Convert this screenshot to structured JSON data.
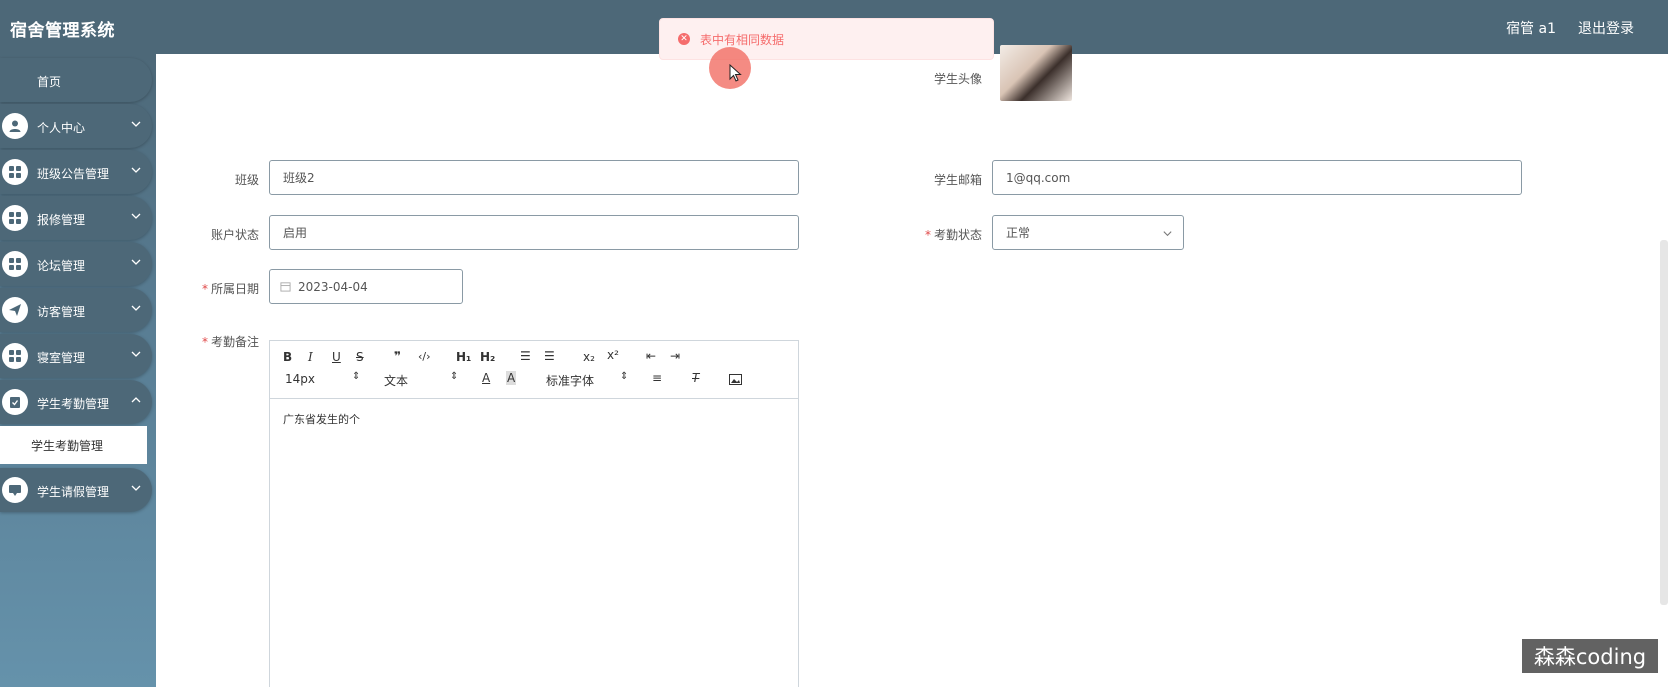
{
  "header": {
    "title": "宿舍管理系统",
    "user": "宿管 a1",
    "logout": "退出登录"
  },
  "sidebar": {
    "home": "首页",
    "items": [
      {
        "label": "个人中心",
        "icon": "user-icon"
      },
      {
        "label": "班级公告管理",
        "icon": "grid-icon"
      },
      {
        "label": "报修管理",
        "icon": "grid-icon"
      },
      {
        "label": "论坛管理",
        "icon": "grid-icon"
      },
      {
        "label": "访客管理",
        "icon": "send-icon"
      },
      {
        "label": "寝室管理",
        "icon": "grid-icon"
      },
      {
        "label": "学生考勤管理",
        "icon": "clipboard-icon"
      },
      {
        "label": "学生请假管理",
        "icon": "chat-icon"
      }
    ],
    "sub_item": "学生考勤管理"
  },
  "toast": {
    "message": "表中有相同数据",
    "color": "#f56c6c"
  },
  "form": {
    "avatar_label": "学生头像",
    "class_label": "班级",
    "class_value": "班级2",
    "email_label": "学生邮箱",
    "email_value": "1@qq.com",
    "account_status_label": "账户状态",
    "account_status_value": "启用",
    "attendance_status_label": "考勤状态",
    "attendance_status_value": "正常",
    "date_label": "所属日期",
    "date_value": "2023-04-04",
    "remark_label": "考勤备注",
    "remark_value": "广东省发生的个",
    "font_size": "14px",
    "text_style": "文本",
    "font_family": "标准字体"
  },
  "watermark": "森森coding",
  "colors": {
    "header": "#4d6878",
    "sidebar_bottom": "#6592ab",
    "required": "#e04848"
  }
}
